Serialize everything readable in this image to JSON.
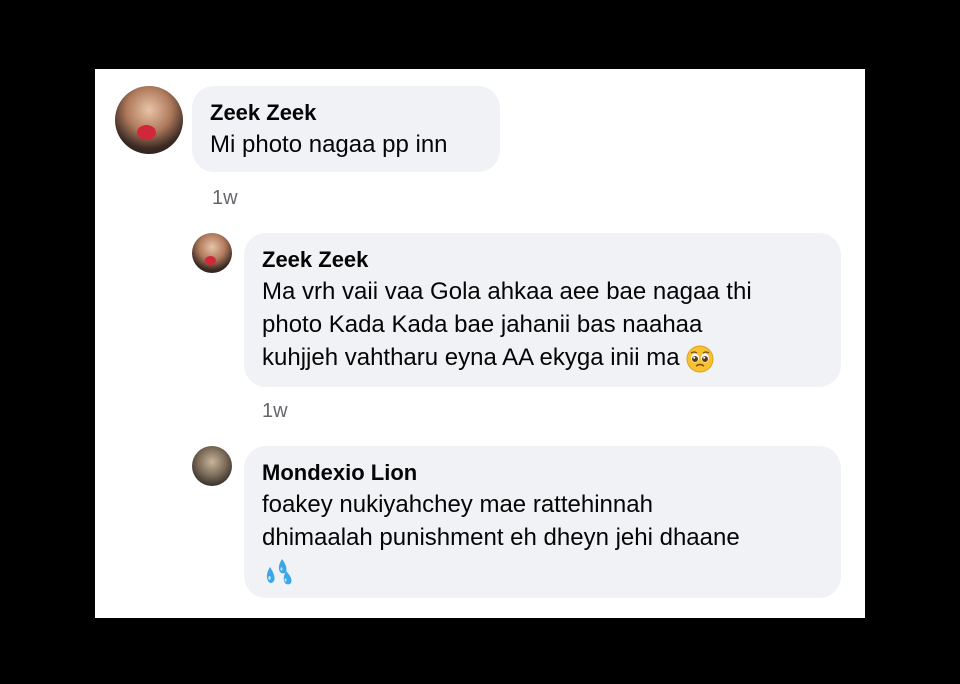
{
  "comments": [
    {
      "author": "Zeek Zeek",
      "text": "Mi photo nagaa pp inn",
      "time": "1w"
    },
    {
      "author": "Zeek Zeek",
      "line1": "Ma vrh vaii vaa Gola ahkaa aee bae nagaa thi",
      "line2": "photo Kada Kada bae jahanii bas naahaa",
      "line3": "kuhjjeh vahtharu eyna AA ekyga inii ma",
      "emoji": "pleading-face",
      "time": "1w"
    },
    {
      "author": "Mondexio Lion",
      "line1": "foakey nukiyahchey mae rattehinnah",
      "line2": "dhimaalah punishment eh dheyn jehi dhaane",
      "emoji": "sweat-droplets"
    }
  ],
  "colors": {
    "bubble": "#f0f2f5",
    "text": "#050505",
    "meta": "#65676b"
  }
}
